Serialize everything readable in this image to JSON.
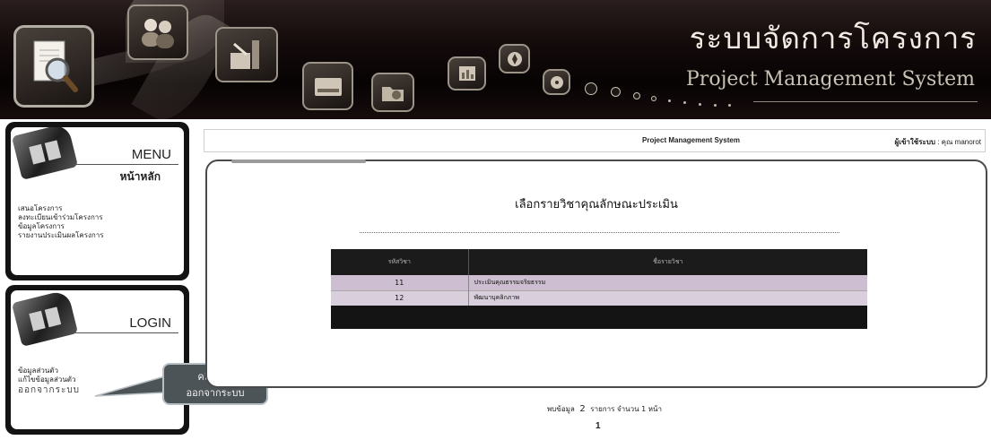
{
  "header": {
    "title_th": "ระบบจัดการโครงการ",
    "title_en": "Project Management System",
    "icons": [
      "magnifier-document-icon",
      "users-icon",
      "tools-icon",
      "hard-drive-icon",
      "folder-icon",
      "chart-icon",
      "compass-icon",
      "disc-icon"
    ]
  },
  "menu_panel": {
    "heading": "MENU",
    "subheading": "หน้าหลัก",
    "items": [
      {
        "label": "เสนอโครงการ"
      },
      {
        "label": "ลงทะเบียนเข้าร่วมโครงการ"
      },
      {
        "label": "ข้อมูลโครงการ"
      },
      {
        "label": "รายงานประเมินผลโครงการ"
      }
    ]
  },
  "login_panel": {
    "heading": "LOGIN",
    "items": [
      {
        "label": "ข้อมูลส่วนตัว"
      },
      {
        "label": "แก้ไขข้อมูลส่วนตัว"
      },
      {
        "label": "ออกจากระบบ"
      }
    ]
  },
  "callout": {
    "line1": "คลิกเมนู",
    "line2": "ออกจากระบบ"
  },
  "topbar": {
    "system_name": "Project Management System",
    "user_label": "ผู้เข้าใช้ระบบ",
    "user_value": " : คุณ manorot"
  },
  "main": {
    "heading": "เลือกรายวิชาคุณลักษณะประเมิน",
    "table": {
      "columns": [
        "รหัสวิชา",
        "ชื่อรายวิชา"
      ],
      "rows": [
        {
          "code": "11",
          "name": "ประเมินคุณธรรมจริยธรรม"
        },
        {
          "code": "12",
          "name": "พัฒนาบุคลิกภาพ"
        }
      ]
    },
    "pager": {
      "prefix": "พบข้อมูล",
      "count": "2",
      "middle": "รายการ จำนวน",
      "pages": "1",
      "suffix": "หน้า",
      "current_page": "1"
    }
  },
  "colors": {
    "banner_bg": "#0e0707",
    "table_header_bg": "#1b1b1b",
    "row_bg": "#cdbfd1",
    "callout_bg": "#4d5458"
  }
}
